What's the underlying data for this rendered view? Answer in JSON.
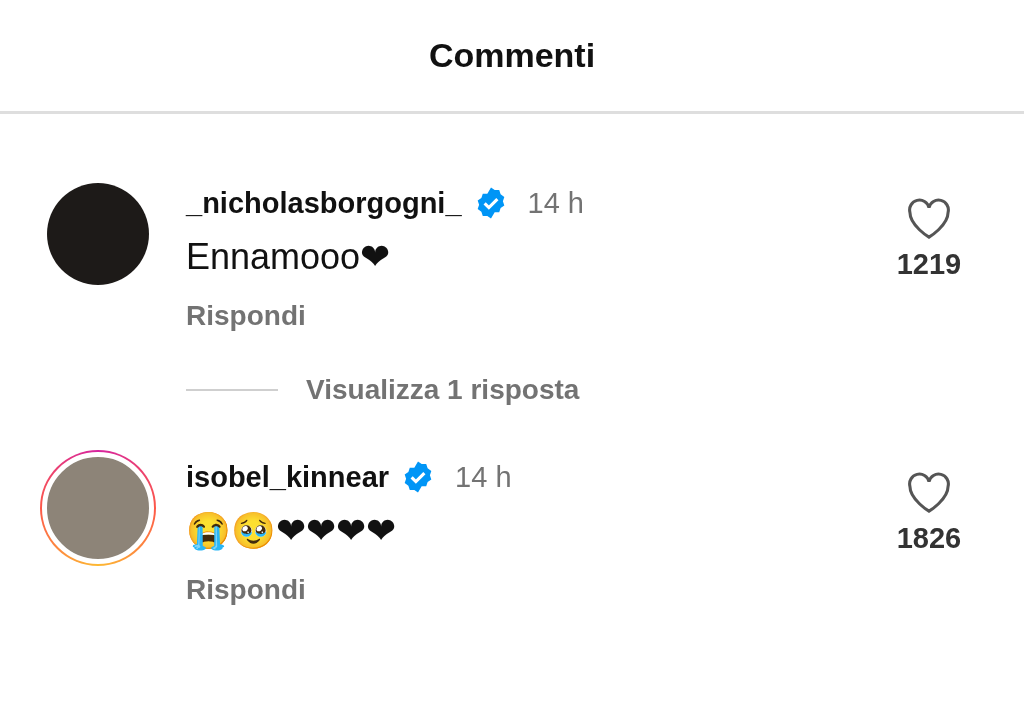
{
  "header": {
    "title": "Commenti"
  },
  "comments": [
    {
      "username": "_nicholasborgogni_",
      "verified": true,
      "time": "14 h",
      "text": "Ennamooo❤",
      "reply_label": "Rispondi",
      "likes": "1219",
      "liked": false,
      "story_ring": false,
      "view_replies": "Visualizza 1 risposta"
    },
    {
      "username": "isobel_kinnear",
      "verified": true,
      "time": "14 h",
      "text": "😭🥹❤❤❤❤",
      "reply_label": "Rispondi",
      "likes": "1826",
      "liked": false,
      "story_ring": true
    }
  ]
}
